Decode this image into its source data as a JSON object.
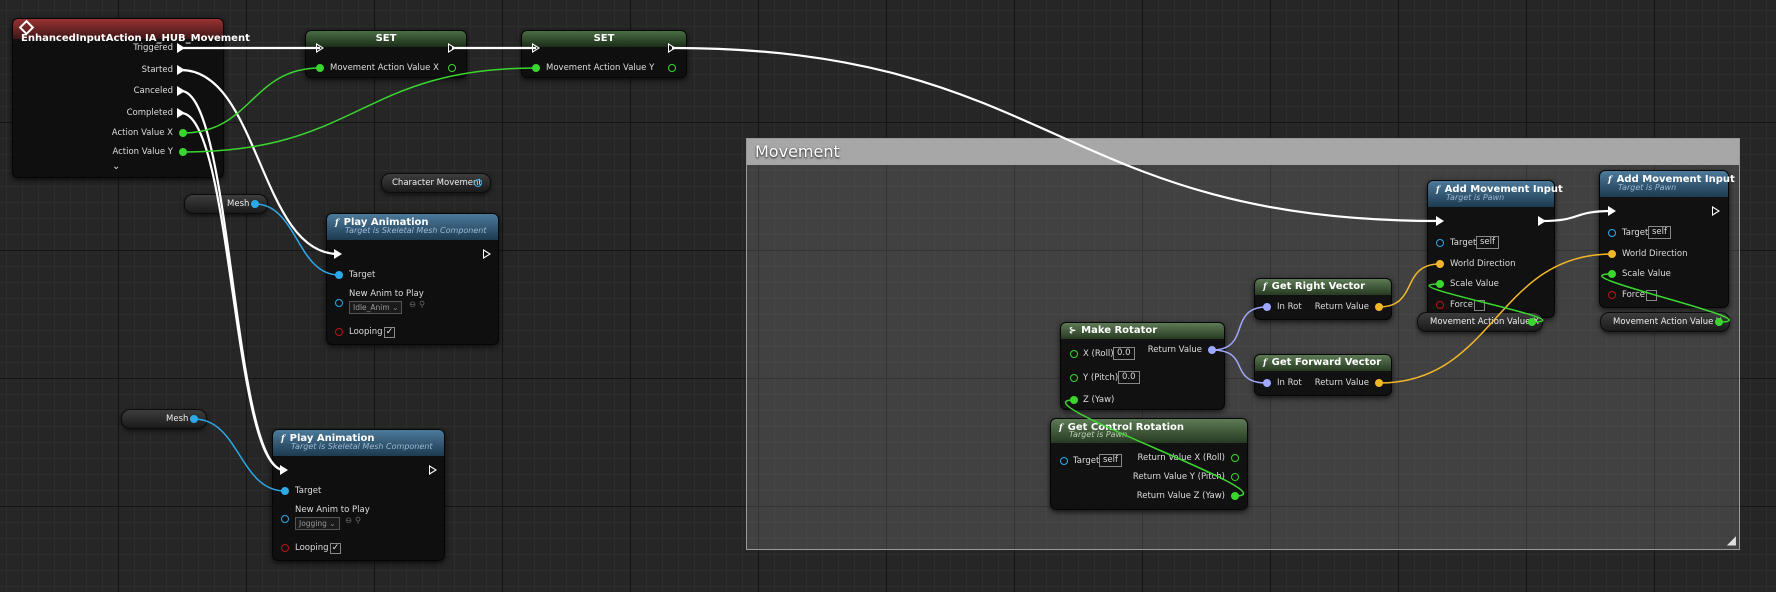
{
  "graph_title": "Movement",
  "colors": {
    "exec": "#ffffff",
    "float": "#3ad62f",
    "vector": "#f2b729",
    "rotator": "#9fa8ff",
    "object": "#2da9e8",
    "bool": "#b91414",
    "struct_pin": "#56c8ff"
  },
  "input_event": {
    "title": "EnhancedInputAction IA_HUB_Movement",
    "icon": "diamond-icon",
    "pins": [
      "Triggered",
      "Started",
      "Canceled",
      "Completed",
      "Action Value X",
      "Action Value Y"
    ],
    "expand_icon": "chevron-down-icon"
  },
  "set_x": {
    "title": "SET",
    "pin": "Movement Action Value X"
  },
  "set_y": {
    "title": "SET",
    "pin": "Movement Action Value Y"
  },
  "character_movement": {
    "label": "Character Movement"
  },
  "mesh_1": {
    "label": "Mesh"
  },
  "mesh_2": {
    "label": "Mesh"
  },
  "play_anim_1": {
    "title": "Play Animation",
    "subtitle": "Target is Skeletal Mesh Component",
    "target": "Target",
    "new_anim": "New Anim to Play",
    "anim_value": "Idle_Anim",
    "looping": "Looping",
    "looping_checked": "✓"
  },
  "play_anim_2": {
    "title": "Play Animation",
    "subtitle": "Target is Skeletal Mesh Component",
    "target": "Target",
    "new_anim": "New Anim to Play",
    "anim_value": "Jogging",
    "looping": "Looping",
    "looping_checked": "✓"
  },
  "add_input_1": {
    "title": "Add Movement Input",
    "subtitle": "Target is Pawn",
    "target": "Target",
    "target_value": "self",
    "world_direction": "World Direction",
    "scale_value": "Scale Value",
    "force": "Force"
  },
  "add_input_2": {
    "title": "Add Movement Input",
    "subtitle": "Target is Pawn",
    "target": "Target",
    "target_value": "self",
    "world_direction": "World Direction",
    "scale_value": "Scale Value",
    "force": "Force"
  },
  "get_right": {
    "title": "Get Right Vector",
    "in": "In Rot",
    "out": "Return Value"
  },
  "get_forward": {
    "title": "Get Forward Vector",
    "in": "In Rot",
    "out": "Return Value"
  },
  "make_rotator": {
    "title": "Make Rotator",
    "x": "X (Roll)",
    "x_val": "0.0",
    "y": "Y (Pitch)",
    "y_val": "0.0",
    "z": "Z (Yaw)",
    "out": "Return Value"
  },
  "get_control_rotation": {
    "title": "Get Control Rotation",
    "subtitle": "Target is Pawn",
    "target": "Target",
    "target_value": "self",
    "out_x": "Return Value X (Roll)",
    "out_y": "Return Value Y (Pitch)",
    "out_z": "Return Value Z (Yaw)"
  },
  "var_x": {
    "label": "Movement Action Value X"
  },
  "var_y": {
    "label": "Movement Action Value Y"
  }
}
